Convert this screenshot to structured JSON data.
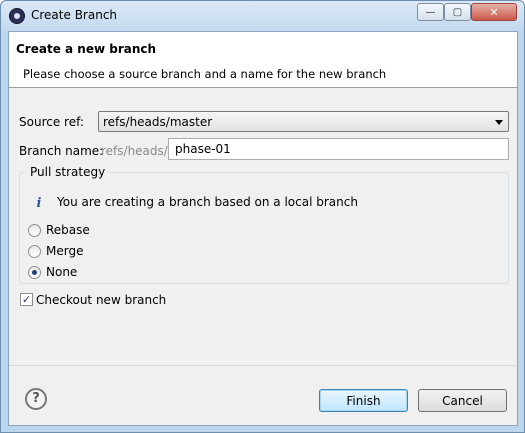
{
  "window": {
    "title": "Create Branch",
    "icon": "eclipse-icon",
    "controls": {
      "minimize": "—",
      "maximize": "▢",
      "close": "✕"
    }
  },
  "header": {
    "title": "Create a new branch",
    "description": "Please choose a source branch and a name for the new branch"
  },
  "form": {
    "source_ref_label": "Source ref:",
    "source_ref_value": "refs/heads/master",
    "branch_name_label": "Branch name:",
    "branch_prefix": "refs/heads/",
    "branch_name_value": "phase-01"
  },
  "pull_strategy": {
    "legend": "Pull strategy",
    "info_icon": "i",
    "info_text": "You are creating a branch based on a local branch",
    "options": [
      {
        "label": "Rebase",
        "selected": false
      },
      {
        "label": "Merge",
        "selected": false
      },
      {
        "label": "None",
        "selected": true
      }
    ]
  },
  "checkout": {
    "label": "Checkout new branch",
    "checked": true,
    "mark": "✓"
  },
  "footer": {
    "help_icon": "?",
    "finish_label": "Finish",
    "cancel_label": "Cancel"
  },
  "colors": {
    "accent": "#3c7fb1",
    "title_bar": "#c3d9ef",
    "dialog_bg": "#f0f0f0"
  }
}
